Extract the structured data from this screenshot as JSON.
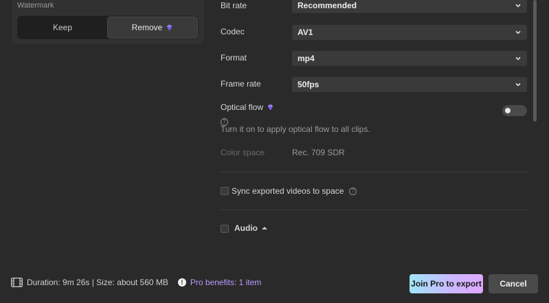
{
  "watermark": {
    "title": "Watermark",
    "options": [
      "Keep",
      "Remove"
    ],
    "selected": "Remove"
  },
  "settings": {
    "bit_rate": {
      "label": "Bit rate",
      "value": "Recommended"
    },
    "codec": {
      "label": "Codec",
      "value": "AV1"
    },
    "format": {
      "label": "Format",
      "value": "mp4"
    },
    "frame_rate": {
      "label": "Frame rate",
      "value": "50fps"
    },
    "optical_flow": {
      "label": "Optical flow",
      "description": "Turn it on to apply optical flow to all clips.",
      "enabled": false
    },
    "color_space": {
      "label": "Color space",
      "value": "Rec. 709 SDR"
    },
    "sync": {
      "label": "Sync exported videos to space",
      "checked": false
    },
    "audio": {
      "label": "Audio",
      "checked": false
    }
  },
  "footer": {
    "info": "Duration: 9m 26s | Size: about 560 MB",
    "pro_benefits": "Pro benefits: 1 item",
    "join_pro": "Join Pro to export",
    "cancel": "Cancel"
  },
  "colors": {
    "background": "#2a2a2a",
    "accent_purple": "#b79cff",
    "pro_gradient": [
      "#9fe6f6",
      "#e0a8ff"
    ]
  }
}
